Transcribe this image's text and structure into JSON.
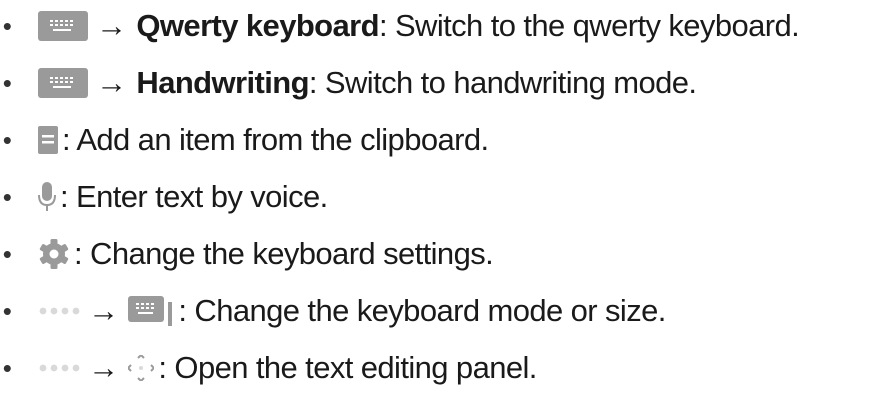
{
  "items": [
    {
      "icon": "keyboard-icon",
      "prefix_arrow": "→",
      "bold": "Qwerty keyboard",
      "text": ": Switch to the qwerty keyboard."
    },
    {
      "icon": "keyboard-icon",
      "prefix_arrow": "→",
      "bold": "Handwriting",
      "text": ": Switch to handwriting mode."
    },
    {
      "icon": "clipboard-icon",
      "text": ": Add an item from the clipboard."
    },
    {
      "icon": "microphone-icon",
      "text": ": Enter text by voice."
    },
    {
      "icon": "gear-icon",
      "text": ": Change the keyboard settings."
    },
    {
      "icon": "more-options-icon",
      "arrow": "→",
      "icon2": "keyboard-mode-icon",
      "text": ": Change the keyboard mode or size."
    },
    {
      "icon": "more-options-icon",
      "arrow": "→",
      "icon2": "text-edit-cursor-icon",
      "text": ": Open the text editing panel."
    }
  ],
  "colors": {
    "icon_gray": "#9a9a9a",
    "icon_light": "#d9d9d9",
    "text": "#1a1a1a"
  }
}
